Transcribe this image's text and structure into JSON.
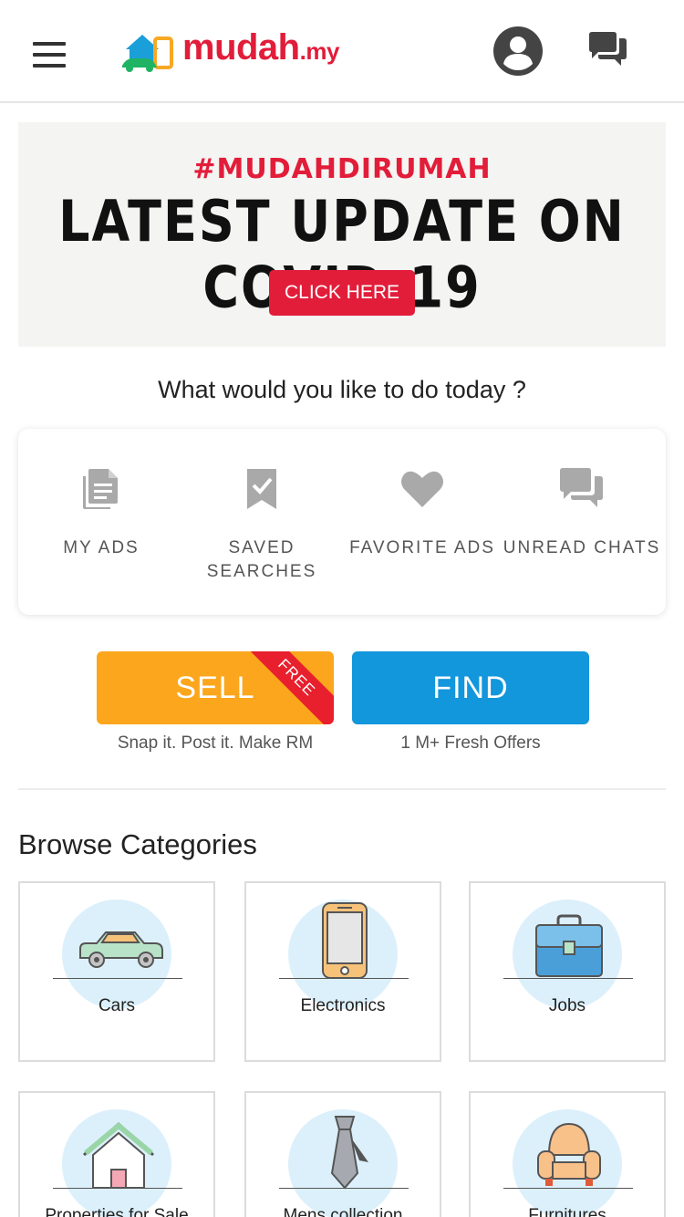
{
  "header": {
    "logo_name": "mudah",
    "logo_tld": ".my",
    "icons": [
      "menu-icon",
      "account-icon",
      "chat-icon"
    ]
  },
  "banner": {
    "hashtag": "#MUDAHDIRUMAH",
    "headline": "LATEST UPDATE ON COVID-19",
    "button_label": "CLICK HERE"
  },
  "question": "What would you like to do today ?",
  "quick_actions": [
    {
      "label": "MY ADS",
      "icon": "document-icon"
    },
    {
      "label": "SAVED SEARCHES",
      "icon": "bookmark-check-icon"
    },
    {
      "label": "FAVORITE ADS",
      "icon": "heart-icon"
    },
    {
      "label": "UNREAD CHATS",
      "icon": "chat-bubbles-icon"
    }
  ],
  "sell": {
    "label": "SELL",
    "ribbon": "FREE",
    "subtitle": "Snap it. Post it. Make RM"
  },
  "find": {
    "label": "FIND",
    "subtitle": "1 M+ Fresh Offers"
  },
  "browse": {
    "title": "Browse Categories",
    "categories": [
      {
        "label": "Cars",
        "icon": "car-icon"
      },
      {
        "label": "Electronics",
        "icon": "smartphone-icon"
      },
      {
        "label": "Jobs",
        "icon": "briefcase-icon"
      },
      {
        "label": "Properties for Sale",
        "icon": "house-icon"
      },
      {
        "label": "Mens collection",
        "icon": "necktie-icon"
      },
      {
        "label": "Furnitures",
        "icon": "armchair-icon"
      }
    ]
  },
  "colors": {
    "brand_red": "#e21d3a",
    "sell_orange": "#fba61c",
    "find_blue": "#1296dc",
    "icon_grey": "#a9a9a9"
  }
}
